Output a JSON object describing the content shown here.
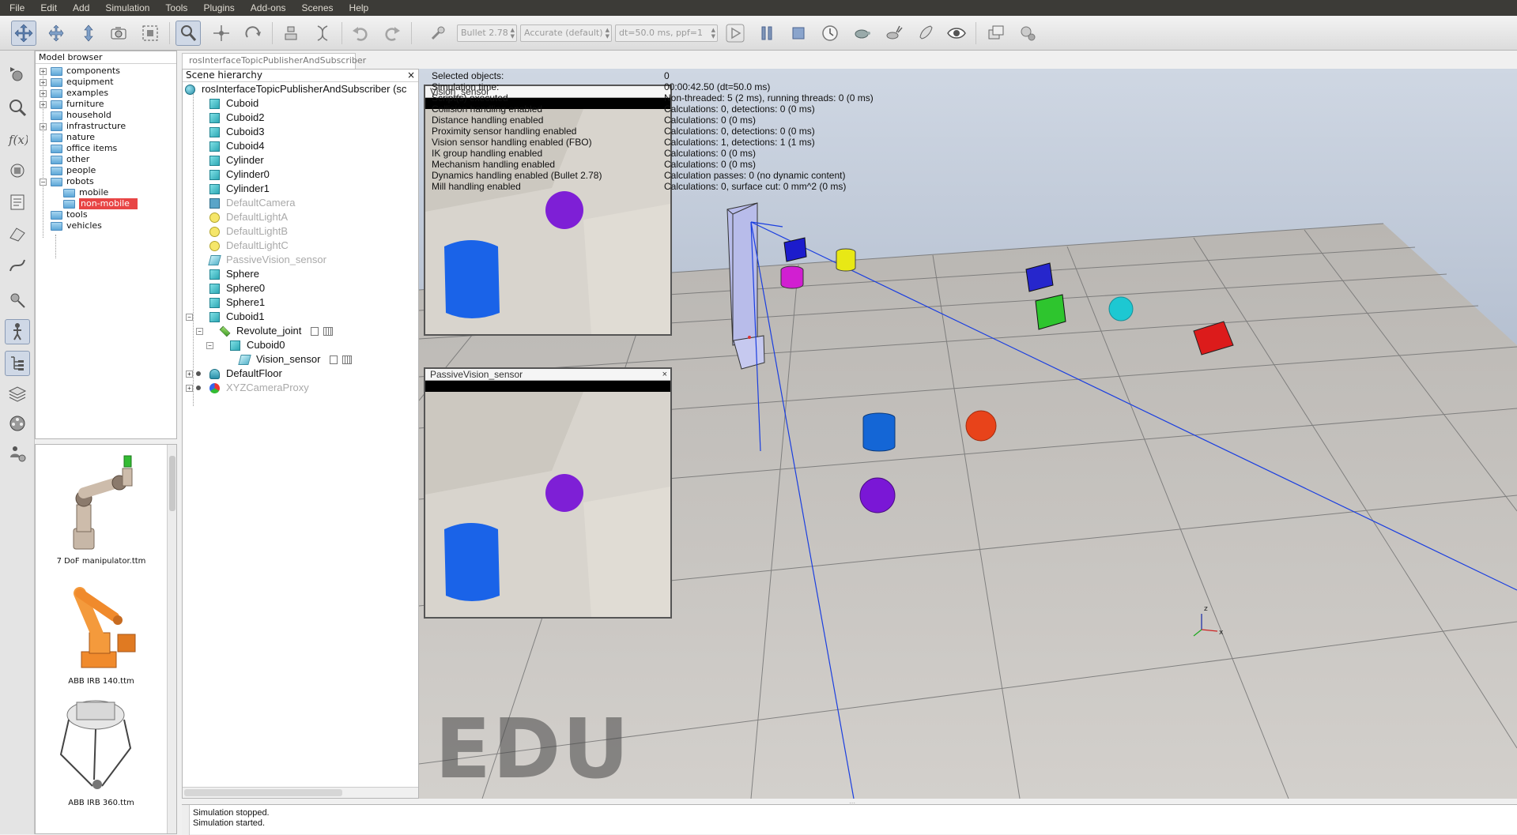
{
  "menubar": {
    "items": [
      "File",
      "Edit",
      "Add",
      "Simulation",
      "Tools",
      "Plugins",
      "Add-ons",
      "Scenes",
      "Help"
    ]
  },
  "toolbar": {
    "engine": "Bullet 2.78",
    "accuracy": "Accurate (default)",
    "timestep": "dt=50.0 ms, ppf=1"
  },
  "model_browser": {
    "title": "Model browser",
    "items": [
      {
        "label": "components",
        "indent": 0,
        "expandable": true
      },
      {
        "label": "equipment",
        "indent": 0,
        "expandable": true
      },
      {
        "label": "examples",
        "indent": 0,
        "expandable": true
      },
      {
        "label": "furniture",
        "indent": 0,
        "expandable": true
      },
      {
        "label": "household",
        "indent": 0,
        "expandable": false
      },
      {
        "label": "infrastructure",
        "indent": 0,
        "expandable": true
      },
      {
        "label": "nature",
        "indent": 0,
        "expandable": false
      },
      {
        "label": "office items",
        "indent": 0,
        "expandable": false
      },
      {
        "label": "other",
        "indent": 0,
        "expandable": false
      },
      {
        "label": "people",
        "indent": 0,
        "expandable": false
      },
      {
        "label": "robots",
        "indent": 0,
        "expandable": true
      },
      {
        "label": "mobile",
        "indent": 1,
        "expandable": false
      },
      {
        "label": "non-mobile",
        "indent": 1,
        "expandable": false,
        "selected": true
      },
      {
        "label": "tools",
        "indent": 0,
        "expandable": false
      },
      {
        "label": "vehicles",
        "indent": 0,
        "expandable": false
      }
    ]
  },
  "thumbnails": [
    {
      "caption": "7 DoF manipulator.ttm"
    },
    {
      "caption": "ABB IRB 140.ttm"
    },
    {
      "caption": "ABB IRB 360.ttm"
    }
  ],
  "scene_tab": "rosInterfaceTopicPublisherAndSubscriber",
  "hierarchy": {
    "title": "Scene hierarchy",
    "root": "rosInterfaceTopicPublisherAndSubscriber (sc",
    "items": [
      {
        "label": "Cuboid",
        "icon": "cube",
        "disabled": false
      },
      {
        "label": "Cuboid2",
        "icon": "cube",
        "disabled": false
      },
      {
        "label": "Cuboid3",
        "icon": "cube",
        "disabled": false
      },
      {
        "label": "Cuboid4",
        "icon": "cube",
        "disabled": false
      },
      {
        "label": "Cylinder",
        "icon": "cube",
        "disabled": false
      },
      {
        "label": "Cylinder0",
        "icon": "cube",
        "disabled": false
      },
      {
        "label": "Cylinder1",
        "icon": "cube",
        "disabled": false
      },
      {
        "label": "DefaultCamera",
        "icon": "camera",
        "disabled": true
      },
      {
        "label": "DefaultLightA",
        "icon": "light",
        "disabled": true
      },
      {
        "label": "DefaultLightB",
        "icon": "light",
        "disabled": true
      },
      {
        "label": "DefaultLightC",
        "icon": "light",
        "disabled": true
      },
      {
        "label": "PassiveVision_sensor",
        "icon": "sensor",
        "disabled": true
      },
      {
        "label": "Sphere",
        "icon": "cube",
        "disabled": false
      },
      {
        "label": "Sphere0",
        "icon": "cube",
        "disabled": false
      },
      {
        "label": "Sphere1",
        "icon": "cube",
        "disabled": false
      },
      {
        "label": "Cuboid1",
        "icon": "cube",
        "disabled": false
      },
      {
        "label": "Revolute_joint",
        "icon": "joint",
        "disabled": false
      },
      {
        "label": "Cuboid0",
        "icon": "cube",
        "disabled": false
      },
      {
        "label": "Vision_sensor",
        "icon": "sensor",
        "disabled": false
      },
      {
        "label": "DefaultFloor",
        "icon": "floor",
        "disabled": false
      },
      {
        "label": "XYZCameraProxy",
        "icon": "proxy",
        "disabled": true
      }
    ]
  },
  "sim_info": [
    {
      "key": "Selected objects:",
      "value": "0"
    },
    {
      "key": "Simulation time:",
      "value": "00:00:42.50 (dt=50.0 ms)"
    },
    {
      "key": "Script(s) executed",
      "value": "Non-threaded: 5 (2 ms), running threads: 0 (0 ms)"
    },
    {
      "key": "Collision handling enabled",
      "value": "Calculations: 0, detections: 0 (0 ms)"
    },
    {
      "key": "Distance handling enabled",
      "value": "Calculations: 0 (0 ms)"
    },
    {
      "key": "Proximity sensor handling enabled",
      "value": "Calculations: 0, detections: 0 (0 ms)"
    },
    {
      "key": "Vision sensor handling enabled (FBO)",
      "value": "Calculations: 1, detections: 1 (1 ms)"
    },
    {
      "key": "IK group handling enabled",
      "value": "Calculations: 0 (0 ms)"
    },
    {
      "key": "Mechanism handling enabled",
      "value": "Calculations: 0 (0 ms)"
    },
    {
      "key": "Dynamics handling enabled (Bullet 2.78)",
      "value": "Calculation passes: 0 (no dynamic content)"
    },
    {
      "key": "Mill handling enabled",
      "value": "Calculations: 0, surface cut: 0 mm^2 (0 ms)"
    }
  ],
  "floating_views": {
    "vision_sensor": {
      "title": "Vision_sensor",
      "close": ""
    },
    "passive_vision": {
      "title": "PassiveVision_sensor",
      "close": "×"
    }
  },
  "watermark": "EDU",
  "axis_labels": {
    "z": "z",
    "x": "x"
  },
  "status": {
    "line1": "Simulation stopped.",
    "line2": "Simulation started."
  },
  "colors": {
    "selection": "#e84545",
    "sensor_ray": "#1a3ee0"
  }
}
